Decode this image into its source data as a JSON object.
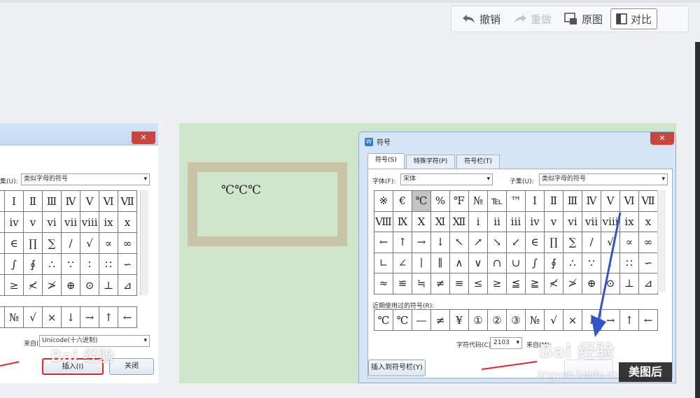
{
  "toolbar": {
    "undo_label": "撤销",
    "redo_label": "重做",
    "original_label": "原图",
    "compare_label": "对比"
  },
  "before": {
    "subset_label": "集(U):",
    "subset_value": "类似字母的符号",
    "grid": [
      [
        "Ⅰ",
        "Ⅱ",
        "Ⅲ",
        "Ⅳ",
        "Ⅴ",
        "Ⅵ",
        "Ⅶ"
      ],
      [
        "ⅳ",
        "ⅴ",
        "ⅵ",
        "ⅶ",
        "ⅷ",
        "ⅸ",
        "ⅹ"
      ],
      [
        "∈",
        "∏",
        "∑",
        "/",
        "√",
        "∝",
        "∞"
      ],
      [
        "∫",
        "∮",
        "∴",
        "∵",
        "∶",
        "∷",
        "∽"
      ],
      [
        "≥",
        "≮",
        "≯",
        "⊕",
        "⊙",
        "⊥",
        "⊿"
      ]
    ],
    "recent": [
      "№",
      "√",
      "×",
      "↓",
      "→",
      "↑",
      "←"
    ],
    "from_label": "来自(M)",
    "from_value": "Unicode(十六进制)",
    "insert_label": "插入(I)",
    "close_label": "关闭"
  },
  "document": {
    "text": "℃℃℃"
  },
  "dialog": {
    "title": "符号",
    "tabs": [
      "符号(S)",
      "特殊字符(P)",
      "符号栏(T)"
    ],
    "font_label": "字体(F):",
    "font_value": "宋体",
    "subset_label": "子集(U):",
    "subset_value": "类似字母的符号",
    "grid": [
      [
        "※",
        "€",
        "℃",
        "%",
        "℉",
        "№",
        "℡",
        "™",
        "Ⅰ",
        "Ⅱ",
        "Ⅲ",
        "Ⅳ",
        "Ⅴ",
        "Ⅵ",
        "Ⅶ"
      ],
      [
        "Ⅷ",
        "Ⅸ",
        "Ⅹ",
        "Ⅺ",
        "Ⅻ",
        "ⅰ",
        "ⅱ",
        "ⅲ",
        "ⅳ",
        "ⅴ",
        "ⅵ",
        "ⅶ",
        "ⅷ",
        "ⅸ",
        "ⅹ"
      ],
      [
        "←",
        "↑",
        "→",
        "↓",
        "↖",
        "↗",
        "↘",
        "↙",
        "∈",
        "∏",
        "∑",
        "/",
        "√",
        "∝",
        "∞"
      ],
      [
        "∟",
        "∠",
        "∣",
        "∥",
        "∧",
        "∨",
        "∩",
        "∪",
        "∫",
        "∮",
        "∴",
        "∵",
        "∶",
        "∷",
        "∽"
      ],
      [
        "≈",
        "≌",
        "≒",
        "≠",
        "≡",
        "≤",
        "≥",
        "≦",
        "≧",
        "≮",
        "≯",
        "⊕",
        "⊙",
        "⊥",
        "⊿"
      ]
    ],
    "selected_cell": "℃",
    "recent_label": "近期使用过的符号(R):",
    "recent": [
      "℃",
      "℃",
      "—",
      "≠",
      "¥",
      "①",
      "②",
      "③",
      "№",
      "√",
      "×",
      "↓",
      "→",
      "↑",
      "←"
    ],
    "code_label": "字符代码(C):",
    "code_value": "2103",
    "from_label": "来自(M):",
    "insert_to_bar_label": "插入到符号栏(Y)"
  },
  "watermarks": {
    "brand": "Bai 经验",
    "url": "jingyan.baidu.com",
    "badge": "美图后"
  },
  "colors": {
    "annotation_red": "#e0262a",
    "annotation_blue": "#2f56c9",
    "doc_bg": "#cfe6cd"
  }
}
